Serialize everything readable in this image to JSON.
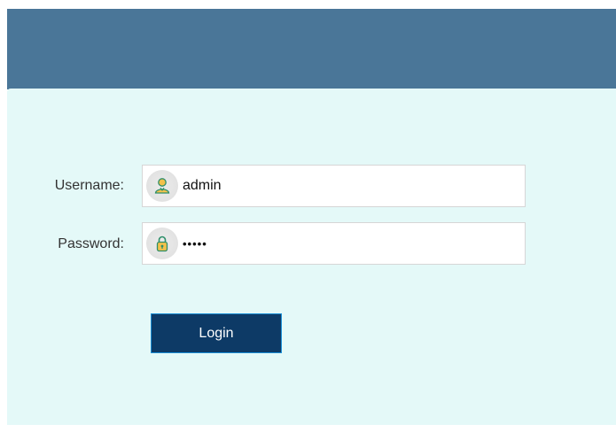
{
  "form": {
    "username_label": "Username:",
    "username_value": "admin",
    "password_label": "Password:",
    "password_value": "•••••",
    "login_label": "Login"
  },
  "icons": {
    "username": "user-icon",
    "password": "lock-icon"
  },
  "colors": {
    "header": "#4a7698",
    "panel": "#e4f9f8",
    "button": "#0d3a66",
    "button_border": "#1b8fd6"
  }
}
